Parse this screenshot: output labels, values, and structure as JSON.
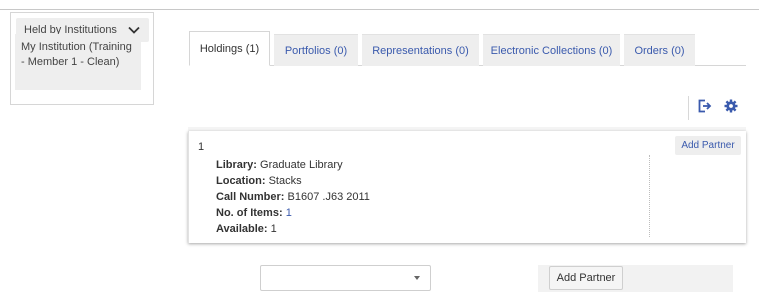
{
  "facet": {
    "header_label": "Held by Institutions",
    "item_label": "My Institution (Training - Member 1 - Clean)"
  },
  "tabs": [
    {
      "label": "Holdings (1)",
      "active": true
    },
    {
      "label": "Portfolios (0)",
      "active": false
    },
    {
      "label": "Representations (0)",
      "active": false
    },
    {
      "label": "Electronic Collections (0)",
      "active": false
    },
    {
      "label": "Orders (0)",
      "active": false
    }
  ],
  "toolbar": {
    "export_icon": "export-icon",
    "settings_icon": "gear-icon"
  },
  "holding": {
    "index": "1",
    "add_partner_label": "Add Partner",
    "fields": {
      "library_label": "Library:",
      "library_value": "Graduate Library",
      "location_label": "Location:",
      "location_value": "Stacks",
      "call_number_label": "Call Number:",
      "call_number_value": "B1607 .J63 2011",
      "items_label": "No. of Items:",
      "items_value": "1",
      "available_label": "Available:",
      "available_value": "1"
    }
  },
  "bottom": {
    "select_value": "",
    "add_partner_label": "Add Partner"
  },
  "colors": {
    "accent": "#3a5aad",
    "tab_bg": "#eeeeee"
  }
}
